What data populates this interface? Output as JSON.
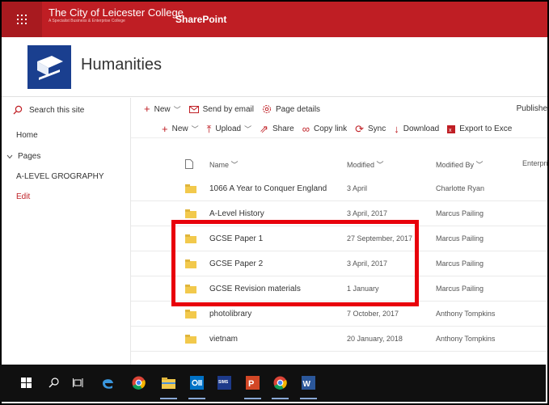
{
  "suite": {
    "org_name": "The City of Leicester College",
    "org_tagline": "A Specialist Business & Enterprise College",
    "app_name": "SharePoint",
    "accent": "#bf1e24"
  },
  "site": {
    "title": "Humanities"
  },
  "leftnav": {
    "search_placeholder": "Search this site",
    "home": "Home",
    "pages": "Pages",
    "a_level": "A-LEVEL GROGRAPHY",
    "edit": "Edit"
  },
  "cmdbar1": {
    "new": "New",
    "send_by_email": "Send by email",
    "page_details": "Page details",
    "published": "Publishe"
  },
  "cmdbar2": {
    "new": "New",
    "upload": "Upload",
    "share": "Share",
    "copy_link": "Copy link",
    "sync": "Sync",
    "download": "Download",
    "export": "Export to Exce"
  },
  "columns": {
    "name": "Name",
    "modified": "Modified",
    "modified_by": "Modified By",
    "enterprise": "Enterpri"
  },
  "files": [
    {
      "name": "1066 A Year to Conquer England",
      "modified": "3 April",
      "modified_by": "Charlotte Ryan"
    },
    {
      "name": "A-Level History",
      "modified": "3 April, 2017",
      "modified_by": "Marcus Pailing"
    },
    {
      "name": "GCSE Paper 1",
      "modified": "27 September, 2017",
      "modified_by": "Marcus Pailing"
    },
    {
      "name": "GCSE Paper 2",
      "modified": "3 April, 2017",
      "modified_by": "Marcus Pailing"
    },
    {
      "name": "GCSE Revision materials",
      "modified": "1 January",
      "modified_by": "Marcus Pailing"
    },
    {
      "name": "photolibrary",
      "modified": "7 October, 2017",
      "modified_by": "Anthony Tompkins"
    },
    {
      "name": "vietnam",
      "modified": "20 January, 2018",
      "modified_by": "Anthony Tompkins"
    }
  ],
  "taskbar": {
    "sims_label": "SIMS"
  }
}
